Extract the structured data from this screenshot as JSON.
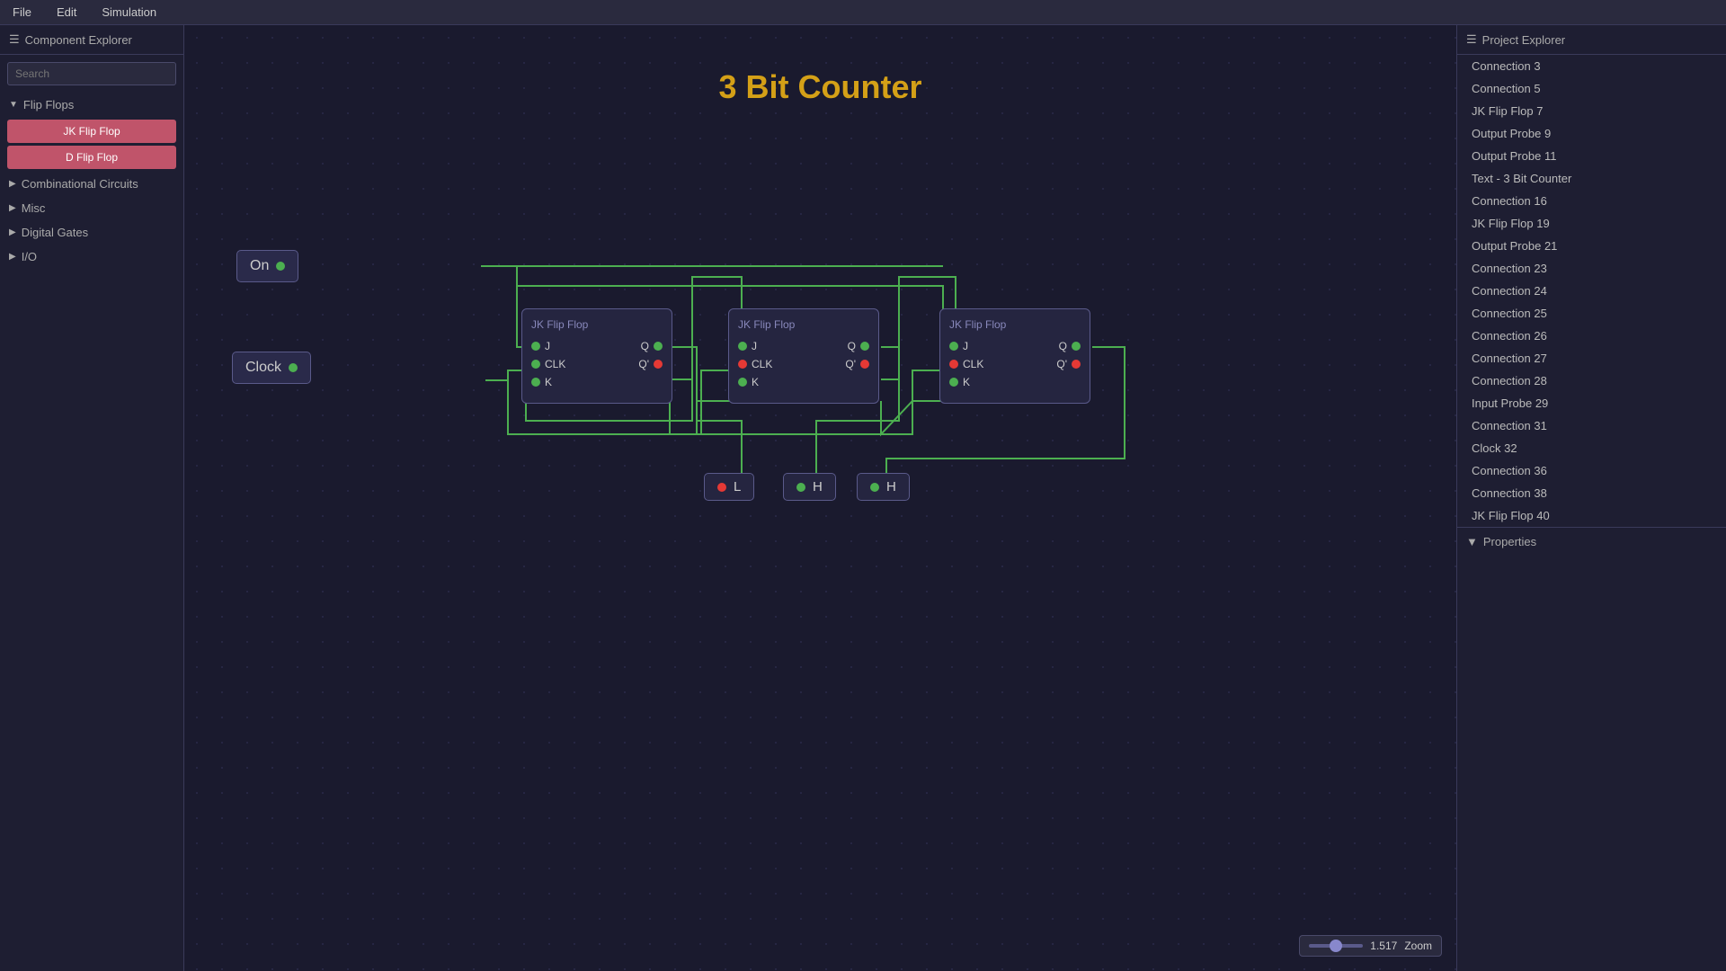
{
  "menubar": {
    "items": [
      "File",
      "Edit",
      "Simulation"
    ]
  },
  "left_sidebar": {
    "header": "Component Explorer",
    "search_placeholder": "Search",
    "sections": [
      {
        "label": "Flip Flops",
        "expanded": true,
        "items": [
          "JK Flip Flop",
          "D Flip Flop"
        ]
      },
      {
        "label": "Combinational Circuits",
        "expanded": false
      },
      {
        "label": "Misc",
        "expanded": false
      },
      {
        "label": "Digital Gates",
        "expanded": false
      },
      {
        "label": "I/O",
        "expanded": false
      }
    ]
  },
  "circuit": {
    "title": "3 Bit Counter"
  },
  "on_button": {
    "label": "On"
  },
  "clock_button": {
    "label": "Clock"
  },
  "jk_cards": [
    {
      "title": "JK Flip Flop",
      "pins_left": [
        "J",
        "CLK",
        "K"
      ],
      "pins_right": [
        "Q",
        "Q'"
      ],
      "q_green": true,
      "q_prime_red": true
    },
    {
      "title": "JK Flip Flop",
      "pins_left": [
        "J",
        "CLK",
        "K"
      ],
      "pins_right": [
        "Q",
        "Q'"
      ],
      "q_green": true,
      "q_prime_red": true
    },
    {
      "title": "JK Flip Flop",
      "pins_left": [
        "J",
        "CLK",
        "K"
      ],
      "pins_right": [
        "Q",
        "Q'"
      ],
      "q_green": true,
      "q_prime_red": true
    }
  ],
  "probes": [
    {
      "label": "L",
      "dot_color": "red"
    },
    {
      "label": "H",
      "dot_color": "green"
    },
    {
      "label": "H",
      "dot_color": "green"
    }
  ],
  "zoom": {
    "value": "1.517",
    "label": "Zoom"
  },
  "right_sidebar": {
    "header": "Project Explorer",
    "items": [
      "Connection 3",
      "Connection 5",
      "JK Flip Flop 7",
      "Output Probe 9",
      "Output Probe 11",
      "Text - 3 Bit Counter",
      "Connection 16",
      "JK Flip Flop 19",
      "Output Probe 21",
      "Connection 23",
      "Connection 24",
      "Connection 25",
      "Connection 26",
      "Connection 27",
      "Connection 28",
      "Input Probe 29",
      "Connection 31",
      "Clock 32",
      "Connection 36",
      "Connection 38",
      "JK Flip Flop 40"
    ],
    "properties_label": "Properties"
  }
}
